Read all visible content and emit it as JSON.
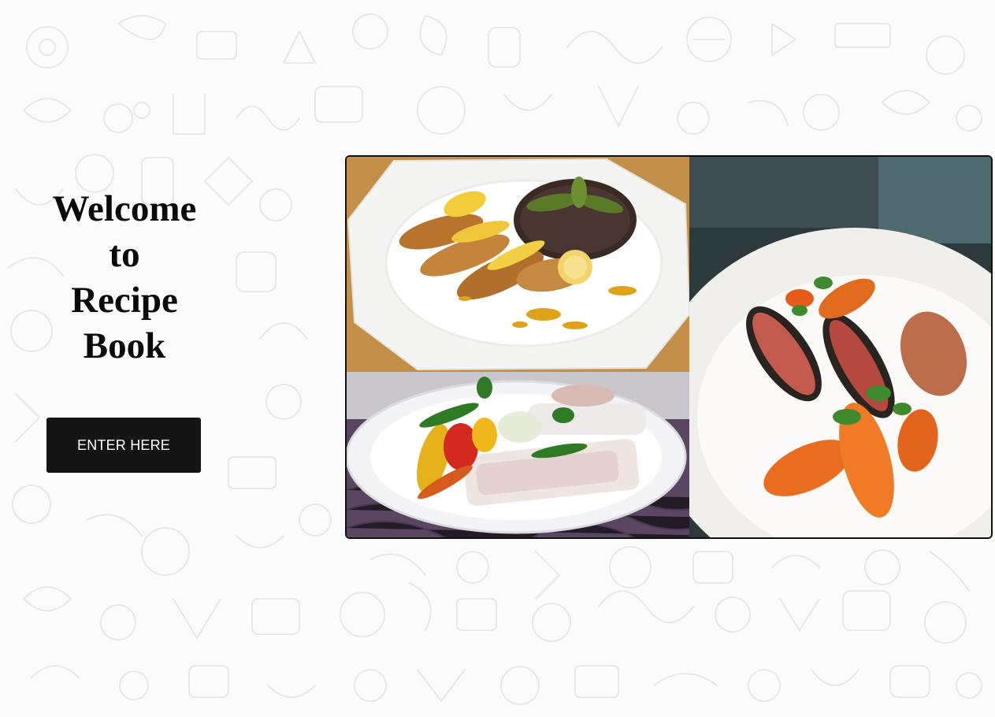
{
  "page": {
    "background": "#fbfbfb",
    "doodle_color": "#e6e6e6"
  },
  "hero": {
    "title_lines": [
      "Welcome",
      "to",
      "Recipe",
      "Book"
    ]
  },
  "cta": {
    "label": "ENTER HERE",
    "background": "#141414",
    "text_color": "#ffffff"
  },
  "gallery": {
    "photos": [
      {
        "name": "chicken-with-lemon-and-wild-rice"
      },
      {
        "name": "fish-with-grilled-peppers"
      },
      {
        "name": "seared-duck-with-carrots"
      }
    ]
  }
}
